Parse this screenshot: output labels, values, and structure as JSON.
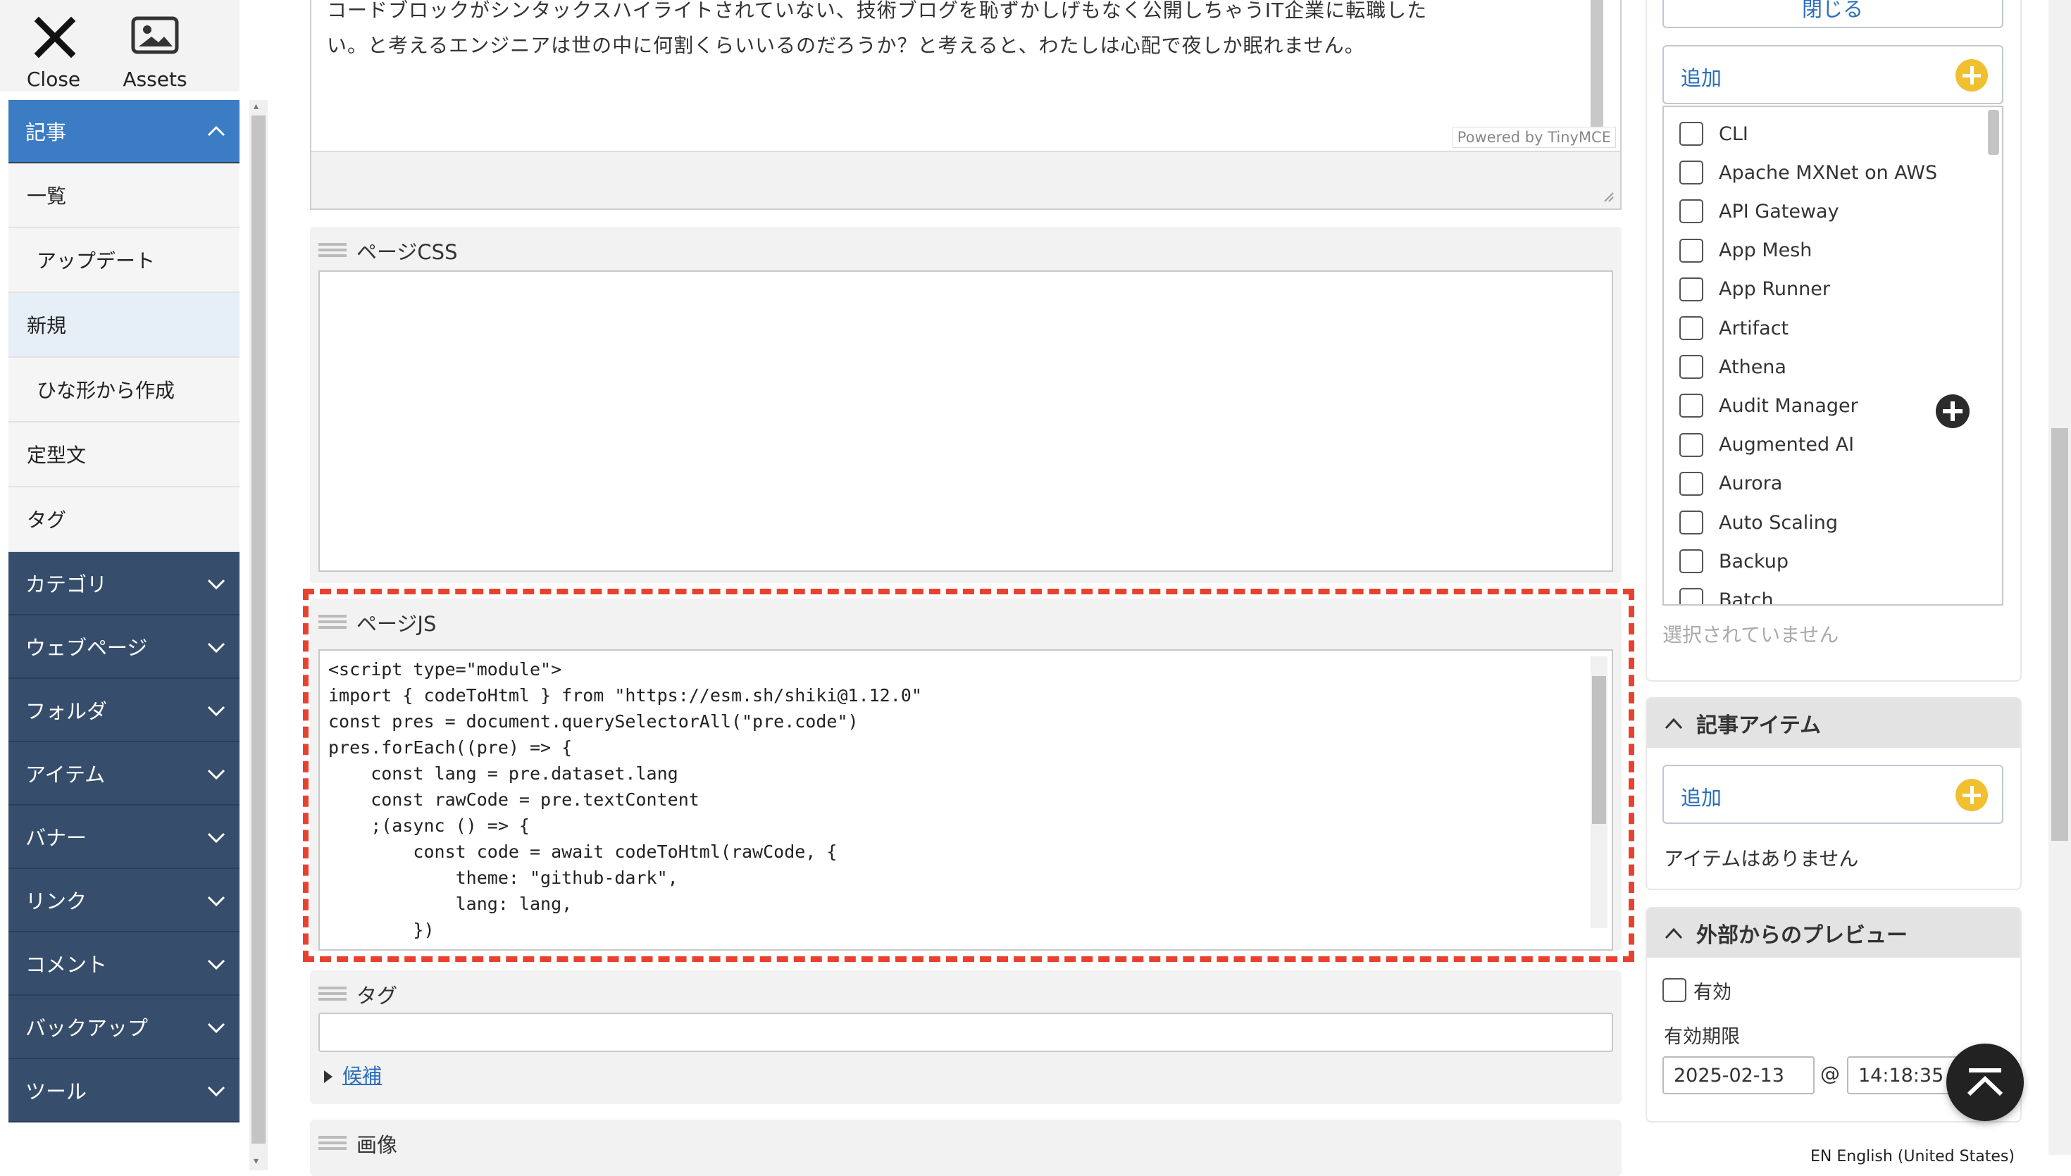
{
  "toolbar": {
    "close_label": "Close",
    "assets_label": "Assets"
  },
  "sidebar": {
    "article_section": "記事",
    "article_items": [
      "一覧",
      "アップデート",
      "新規",
      "ひな形から作成",
      "定型文",
      "タグ"
    ],
    "sections": [
      "カテゴリ",
      "ウェブページ",
      "フォルダ",
      "アイテム",
      "バナー",
      "リンク",
      "コメント",
      "バックアップ",
      "ツール"
    ]
  },
  "editor": {
    "text_line1": "コードブロックがシンタックスハイライトされていない、技術ブログを恥ずかしげもなく公開しちゃうIT企業に転職した",
    "text_line2": "い。と考えるエンジニアは世の中に何割くらいいるのだろうか？と考えると、わたしは心配で夜しか眠れません。",
    "powered": "Powered by TinyMCE"
  },
  "page_css": {
    "label": "ページCSS",
    "value": ""
  },
  "page_js": {
    "label": "ページJS",
    "code_lines": [
      "<script type=\"module\">",
      "import { codeToHtml } from \"https://esm.sh/shiki@1.12.0\"",
      "const pres = document.querySelectorAll(\"pre.code\")",
      "pres.forEach((pre) => {",
      "    const lang = pre.dataset.lang",
      "    const rawCode = pre.textContent",
      "    ;(async () => {",
      "        const code = await codeToHtml(rawCode, {",
      "            theme: \"github-dark\",",
      "            lang: lang,",
      "        })"
    ]
  },
  "tag_panel": {
    "label": "タグ",
    "candidates_label": "候補"
  },
  "image_panel": {
    "label": "画像"
  },
  "right": {
    "collapse_link": "閉じる",
    "add_label": "追加",
    "categories": [
      "CLI",
      "Apache MXNet on AWS",
      "API Gateway",
      "App Mesh",
      "App Runner",
      "Artifact",
      "Athena",
      "Audit Manager",
      "Augmented AI",
      "Aurora",
      "Auto Scaling",
      "Backup",
      "Batch"
    ],
    "none_selected": "選択されていません",
    "article_items_title": "記事アイテム",
    "article_items_add": "追加",
    "no_items": "アイテムはありません",
    "preview_title": "外部からのプレビュー",
    "enabled_label": "有効",
    "expiry_label": "有効期限",
    "expiry_date": "2025-02-13",
    "at": "@",
    "expiry_time": "14:18:35"
  },
  "footer": {
    "language": "EN English (United States)"
  },
  "colors": {
    "accent": "#3c7cc4",
    "sidebar": "#364e6c",
    "highlight": "#e8422e",
    "add_icon": "#f0c030"
  }
}
